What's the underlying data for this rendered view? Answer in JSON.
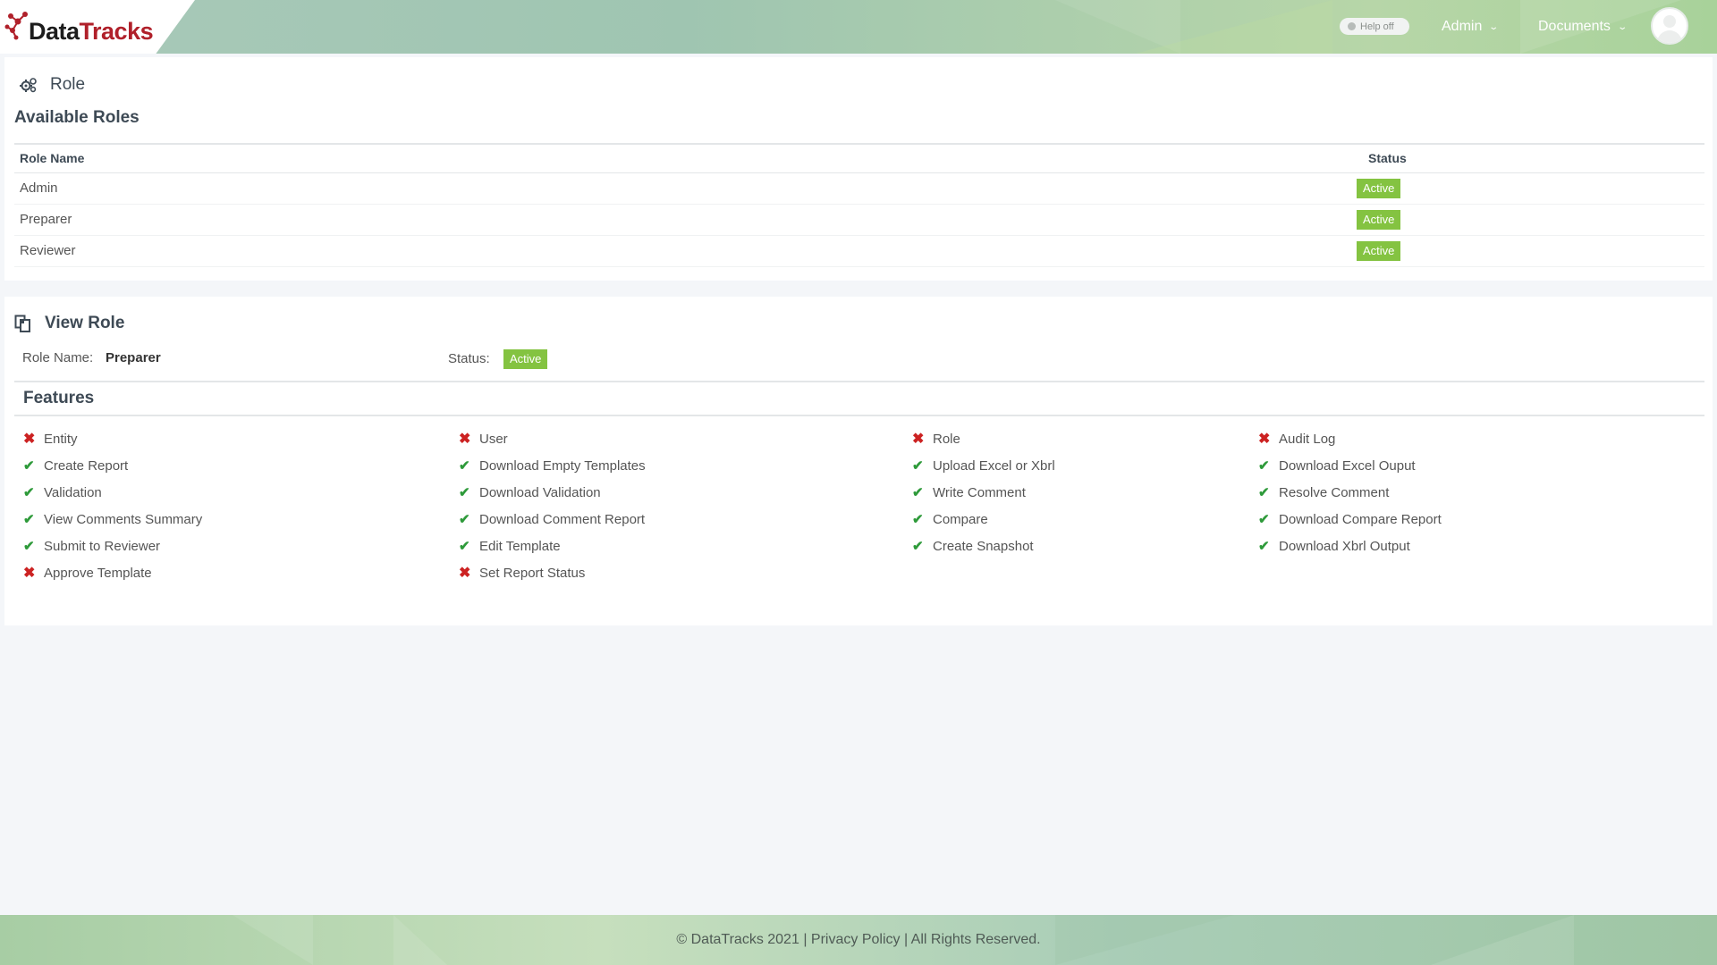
{
  "brand": {
    "name_part1": "Data",
    "name_part2": "Tracks",
    "colors": {
      "dark": "#1d1d1d",
      "red": "#b0202a"
    }
  },
  "header": {
    "help_toggle": "Help off",
    "nav": [
      {
        "label": "Admin",
        "icon": "chevron-down-icon"
      },
      {
        "label": "Documents",
        "icon": "chevron-down-icon"
      }
    ],
    "avatar_icon": "user-avatar-icon"
  },
  "role_panel": {
    "title": "Role",
    "icon": "gears-icon",
    "subtitle": "Available Roles",
    "columns": [
      "Role Name",
      "Status"
    ],
    "rows": [
      {
        "name": "Admin",
        "status": "Active"
      },
      {
        "name": "Preparer",
        "status": "Active"
      },
      {
        "name": "Reviewer",
        "status": "Active"
      }
    ]
  },
  "view_role": {
    "title": "View Role",
    "icon": "copy-documents-icon",
    "role_name_label": "Role Name:",
    "role_name_value": "Preparer",
    "status_label": "Status:",
    "status_value": "Active",
    "features_heading": "Features",
    "features": [
      [
        {
          "label": "Entity",
          "enabled": false
        },
        {
          "label": "Create Report",
          "enabled": true
        },
        {
          "label": "Validation",
          "enabled": true
        },
        {
          "label": "View Comments Summary",
          "enabled": true
        },
        {
          "label": "Submit to Reviewer",
          "enabled": true
        },
        {
          "label": "Approve Template",
          "enabled": false
        }
      ],
      [
        {
          "label": "User",
          "enabled": false
        },
        {
          "label": "Download Empty Templates",
          "enabled": true
        },
        {
          "label": "Download Validation",
          "enabled": true
        },
        {
          "label": "Download Comment Report",
          "enabled": true
        },
        {
          "label": "Edit Template",
          "enabled": true
        },
        {
          "label": "Set Report Status",
          "enabled": false
        }
      ],
      [
        {
          "label": "Role",
          "enabled": false
        },
        {
          "label": "Upload Excel or Xbrl",
          "enabled": true
        },
        {
          "label": "Write Comment",
          "enabled": true
        },
        {
          "label": "Compare",
          "enabled": true
        },
        {
          "label": "Create Snapshot",
          "enabled": true
        }
      ],
      [
        {
          "label": "Audit Log",
          "enabled": false
        },
        {
          "label": "Download Excel Ouput",
          "enabled": true
        },
        {
          "label": "Resolve Comment",
          "enabled": true
        },
        {
          "label": "Download Compare Report",
          "enabled": true
        },
        {
          "label": "Download Xbrl Output",
          "enabled": true
        }
      ]
    ]
  },
  "footer": {
    "copyright": "© DataTracks 2021",
    "separator1": "|",
    "privacy_link": "Privacy Policy",
    "separator2": "|",
    "rights": "All Rights Reserved."
  },
  "colors": {
    "active_badge": "#84c341",
    "check": "#2e9a3a",
    "cross": "#cc2222"
  }
}
